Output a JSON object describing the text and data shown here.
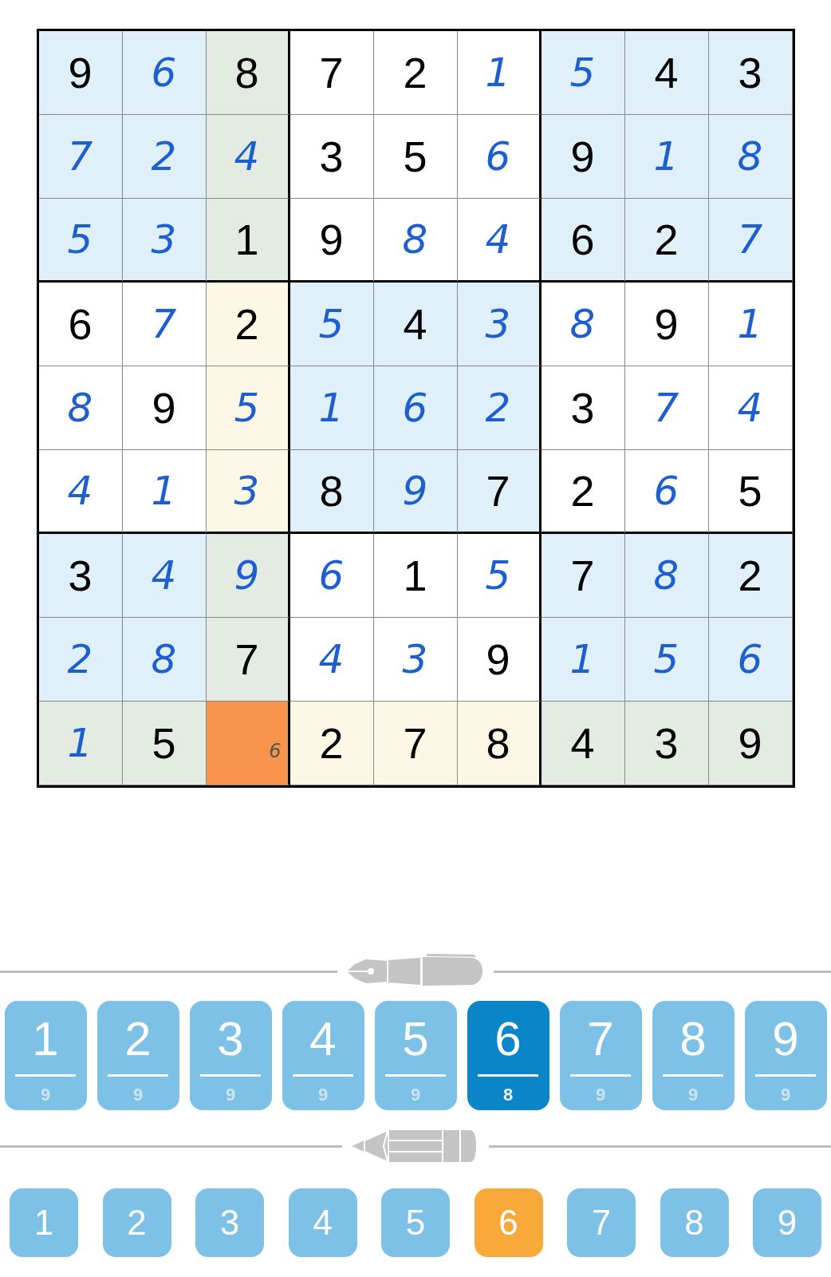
{
  "board": {
    "rows": [
      [
        {
          "kind": "given",
          "value": "9",
          "tinted": true,
          "highlighted": false,
          "selected": false
        },
        {
          "kind": "entry",
          "value": "6",
          "tinted": true,
          "highlighted": false,
          "selected": false
        },
        {
          "kind": "given",
          "value": "8",
          "tinted": true,
          "highlighted": true,
          "selected": false
        },
        {
          "kind": "given",
          "value": "7",
          "tinted": false,
          "highlighted": false,
          "selected": false
        },
        {
          "kind": "given",
          "value": "2",
          "tinted": false,
          "highlighted": false,
          "selected": false
        },
        {
          "kind": "entry",
          "value": "1",
          "tinted": false,
          "highlighted": false,
          "selected": false
        },
        {
          "kind": "entry",
          "value": "5",
          "tinted": true,
          "highlighted": false,
          "selected": false
        },
        {
          "kind": "given",
          "value": "4",
          "tinted": true,
          "highlighted": false,
          "selected": false
        },
        {
          "kind": "given",
          "value": "3",
          "tinted": true,
          "highlighted": false,
          "selected": false
        }
      ],
      [
        {
          "kind": "entry",
          "value": "7",
          "tinted": true,
          "highlighted": false,
          "selected": false
        },
        {
          "kind": "entry",
          "value": "2",
          "tinted": true,
          "highlighted": false,
          "selected": false
        },
        {
          "kind": "entry",
          "value": "4",
          "tinted": true,
          "highlighted": true,
          "selected": false
        },
        {
          "kind": "given",
          "value": "3",
          "tinted": false,
          "highlighted": false,
          "selected": false
        },
        {
          "kind": "given",
          "value": "5",
          "tinted": false,
          "highlighted": false,
          "selected": false
        },
        {
          "kind": "entry",
          "value": "6",
          "tinted": false,
          "highlighted": false,
          "selected": false
        },
        {
          "kind": "given",
          "value": "9",
          "tinted": true,
          "highlighted": false,
          "selected": false
        },
        {
          "kind": "entry",
          "value": "1",
          "tinted": true,
          "highlighted": false,
          "selected": false
        },
        {
          "kind": "entry",
          "value": "8",
          "tinted": true,
          "highlighted": false,
          "selected": false
        }
      ],
      [
        {
          "kind": "entry",
          "value": "5",
          "tinted": true,
          "highlighted": false,
          "selected": false
        },
        {
          "kind": "entry",
          "value": "3",
          "tinted": true,
          "highlighted": false,
          "selected": false
        },
        {
          "kind": "given",
          "value": "1",
          "tinted": true,
          "highlighted": true,
          "selected": false
        },
        {
          "kind": "given",
          "value": "9",
          "tinted": false,
          "highlighted": false,
          "selected": false
        },
        {
          "kind": "entry",
          "value": "8",
          "tinted": false,
          "highlighted": false,
          "selected": false
        },
        {
          "kind": "entry",
          "value": "4",
          "tinted": false,
          "highlighted": false,
          "selected": false
        },
        {
          "kind": "given",
          "value": "6",
          "tinted": true,
          "highlighted": false,
          "selected": false
        },
        {
          "kind": "given",
          "value": "2",
          "tinted": true,
          "highlighted": false,
          "selected": false
        },
        {
          "kind": "entry",
          "value": "7",
          "tinted": true,
          "highlighted": false,
          "selected": false
        }
      ],
      [
        {
          "kind": "given",
          "value": "6",
          "tinted": false,
          "highlighted": false,
          "selected": false
        },
        {
          "kind": "entry",
          "value": "7",
          "tinted": false,
          "highlighted": false,
          "selected": false
        },
        {
          "kind": "given",
          "value": "2",
          "tinted": false,
          "highlighted": true,
          "selected": false
        },
        {
          "kind": "entry",
          "value": "5",
          "tinted": true,
          "highlighted": false,
          "selected": false
        },
        {
          "kind": "given",
          "value": "4",
          "tinted": true,
          "highlighted": false,
          "selected": false
        },
        {
          "kind": "entry",
          "value": "3",
          "tinted": true,
          "highlighted": false,
          "selected": false
        },
        {
          "kind": "entry",
          "value": "8",
          "tinted": false,
          "highlighted": false,
          "selected": false
        },
        {
          "kind": "given",
          "value": "9",
          "tinted": false,
          "highlighted": false,
          "selected": false
        },
        {
          "kind": "entry",
          "value": "1",
          "tinted": false,
          "highlighted": false,
          "selected": false
        }
      ],
      [
        {
          "kind": "entry",
          "value": "8",
          "tinted": false,
          "highlighted": false,
          "selected": false
        },
        {
          "kind": "given",
          "value": "9",
          "tinted": false,
          "highlighted": false,
          "selected": false
        },
        {
          "kind": "entry",
          "value": "5",
          "tinted": false,
          "highlighted": true,
          "selected": false
        },
        {
          "kind": "entry",
          "value": "1",
          "tinted": true,
          "highlighted": false,
          "selected": false
        },
        {
          "kind": "entry",
          "value": "6",
          "tinted": true,
          "highlighted": false,
          "selected": false
        },
        {
          "kind": "entry",
          "value": "2",
          "tinted": true,
          "highlighted": false,
          "selected": false
        },
        {
          "kind": "given",
          "value": "3",
          "tinted": false,
          "highlighted": false,
          "selected": false
        },
        {
          "kind": "entry",
          "value": "7",
          "tinted": false,
          "highlighted": false,
          "selected": false
        },
        {
          "kind": "entry",
          "value": "4",
          "tinted": false,
          "highlighted": false,
          "selected": false
        }
      ],
      [
        {
          "kind": "entry",
          "value": "4",
          "tinted": false,
          "highlighted": false,
          "selected": false
        },
        {
          "kind": "entry",
          "value": "1",
          "tinted": false,
          "highlighted": false,
          "selected": false
        },
        {
          "kind": "entry",
          "value": "3",
          "tinted": false,
          "highlighted": true,
          "selected": false
        },
        {
          "kind": "given",
          "value": "8",
          "tinted": true,
          "highlighted": false,
          "selected": false
        },
        {
          "kind": "entry",
          "value": "9",
          "tinted": true,
          "highlighted": false,
          "selected": false
        },
        {
          "kind": "given",
          "value": "7",
          "tinted": true,
          "highlighted": false,
          "selected": false
        },
        {
          "kind": "given",
          "value": "2",
          "tinted": false,
          "highlighted": false,
          "selected": false
        },
        {
          "kind": "entry",
          "value": "6",
          "tinted": false,
          "highlighted": false,
          "selected": false
        },
        {
          "kind": "given",
          "value": "5",
          "tinted": false,
          "highlighted": false,
          "selected": false
        }
      ],
      [
        {
          "kind": "given",
          "value": "3",
          "tinted": true,
          "highlighted": false,
          "selected": false
        },
        {
          "kind": "entry",
          "value": "4",
          "tinted": true,
          "highlighted": false,
          "selected": false
        },
        {
          "kind": "entry",
          "value": "9",
          "tinted": true,
          "highlighted": true,
          "selected": false
        },
        {
          "kind": "entry",
          "value": "6",
          "tinted": false,
          "highlighted": false,
          "selected": false
        },
        {
          "kind": "given",
          "value": "1",
          "tinted": false,
          "highlighted": false,
          "selected": false
        },
        {
          "kind": "entry",
          "value": "5",
          "tinted": false,
          "highlighted": false,
          "selected": false
        },
        {
          "kind": "given",
          "value": "7",
          "tinted": true,
          "highlighted": false,
          "selected": false
        },
        {
          "kind": "entry",
          "value": "8",
          "tinted": true,
          "highlighted": false,
          "selected": false
        },
        {
          "kind": "given",
          "value": "2",
          "tinted": true,
          "highlighted": false,
          "selected": false
        }
      ],
      [
        {
          "kind": "entry",
          "value": "2",
          "tinted": true,
          "highlighted": false,
          "selected": false
        },
        {
          "kind": "entry",
          "value": "8",
          "tinted": true,
          "highlighted": false,
          "selected": false
        },
        {
          "kind": "given",
          "value": "7",
          "tinted": true,
          "highlighted": true,
          "selected": false
        },
        {
          "kind": "entry",
          "value": "4",
          "tinted": false,
          "highlighted": false,
          "selected": false
        },
        {
          "kind": "entry",
          "value": "3",
          "tinted": false,
          "highlighted": false,
          "selected": false
        },
        {
          "kind": "given",
          "value": "9",
          "tinted": false,
          "highlighted": false,
          "selected": false
        },
        {
          "kind": "entry",
          "value": "1",
          "tinted": true,
          "highlighted": false,
          "selected": false
        },
        {
          "kind": "entry",
          "value": "5",
          "tinted": true,
          "highlighted": false,
          "selected": false
        },
        {
          "kind": "entry",
          "value": "6",
          "tinted": true,
          "highlighted": false,
          "selected": false
        }
      ],
      [
        {
          "kind": "entry",
          "value": "1",
          "tinted": true,
          "highlighted": true,
          "selected": false
        },
        {
          "kind": "given",
          "value": "5",
          "tinted": true,
          "highlighted": true,
          "selected": false
        },
        {
          "kind": "note",
          "value": "6",
          "selected": true
        },
        {
          "kind": "given",
          "value": "2",
          "tinted": false,
          "highlighted": true,
          "selected": false
        },
        {
          "kind": "given",
          "value": "7",
          "tinted": false,
          "highlighted": true,
          "selected": false
        },
        {
          "kind": "given",
          "value": "8",
          "tinted": false,
          "highlighted": true,
          "selected": false
        },
        {
          "kind": "given",
          "value": "4",
          "tinted": true,
          "highlighted": true,
          "selected": false
        },
        {
          "kind": "given",
          "value": "3",
          "tinted": true,
          "highlighted": true,
          "selected": false
        },
        {
          "kind": "given",
          "value": "9",
          "tinted": true,
          "highlighted": true,
          "selected": false
        }
      ]
    ]
  },
  "pen_keys": [
    {
      "digit": "1",
      "count": "9",
      "selected": false
    },
    {
      "digit": "2",
      "count": "9",
      "selected": false
    },
    {
      "digit": "3",
      "count": "9",
      "selected": false
    },
    {
      "digit": "4",
      "count": "9",
      "selected": false
    },
    {
      "digit": "5",
      "count": "9",
      "selected": false
    },
    {
      "digit": "6",
      "count": "8",
      "selected": true
    },
    {
      "digit": "7",
      "count": "9",
      "selected": false
    },
    {
      "digit": "8",
      "count": "9",
      "selected": false
    },
    {
      "digit": "9",
      "count": "9",
      "selected": false
    }
  ],
  "pencil_keys": [
    {
      "digit": "1",
      "selected": false
    },
    {
      "digit": "2",
      "selected": false
    },
    {
      "digit": "3",
      "selected": false
    },
    {
      "digit": "4",
      "selected": false
    },
    {
      "digit": "5",
      "selected": false
    },
    {
      "digit": "6",
      "selected": true
    },
    {
      "digit": "7",
      "selected": false
    },
    {
      "digit": "8",
      "selected": false
    },
    {
      "digit": "9",
      "selected": false
    }
  ]
}
